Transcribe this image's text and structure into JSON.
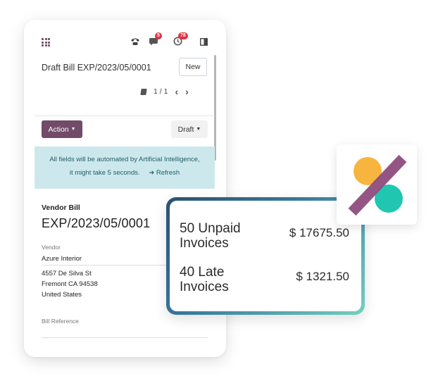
{
  "topbar": {
    "messages_count": "5",
    "activities_count": "78"
  },
  "record": {
    "title": "Draft Bill EXP/2023/05/0001",
    "new_label": "New",
    "pager_text": "1 / 1"
  },
  "statusbar": {
    "action_label": "Action",
    "state_label": "Draft"
  },
  "ai_banner": {
    "line1": "All fields will be automated by Artificial Intelligence,",
    "line2": "it might take 5 seconds.",
    "refresh_label": "Refresh"
  },
  "form": {
    "section_label": "Vendor Bill",
    "bill_number": "EXP/2023/05/0001",
    "vendor_label": "Vendor",
    "vendor_value": "Azure Interior",
    "address": [
      "4557 De Silva St",
      "Fremont CA 94538",
      "United States"
    ],
    "bill_reference_label": "Bill Reference"
  },
  "invoices_card": {
    "unpaid_label_line1": "50 Unpaid",
    "unpaid_label_line2": "Invoices",
    "unpaid_amount": "$ 17675.50",
    "late_label_line1": "40 Late",
    "late_label_line2": "Invoices",
    "late_amount": "$ 1321.50"
  },
  "colors": {
    "brand": "#714b67",
    "banner_bg": "#cde8ec",
    "logo_orange": "#f7b540",
    "logo_teal": "#21c6b1",
    "logo_purple": "#8f4c7e"
  }
}
